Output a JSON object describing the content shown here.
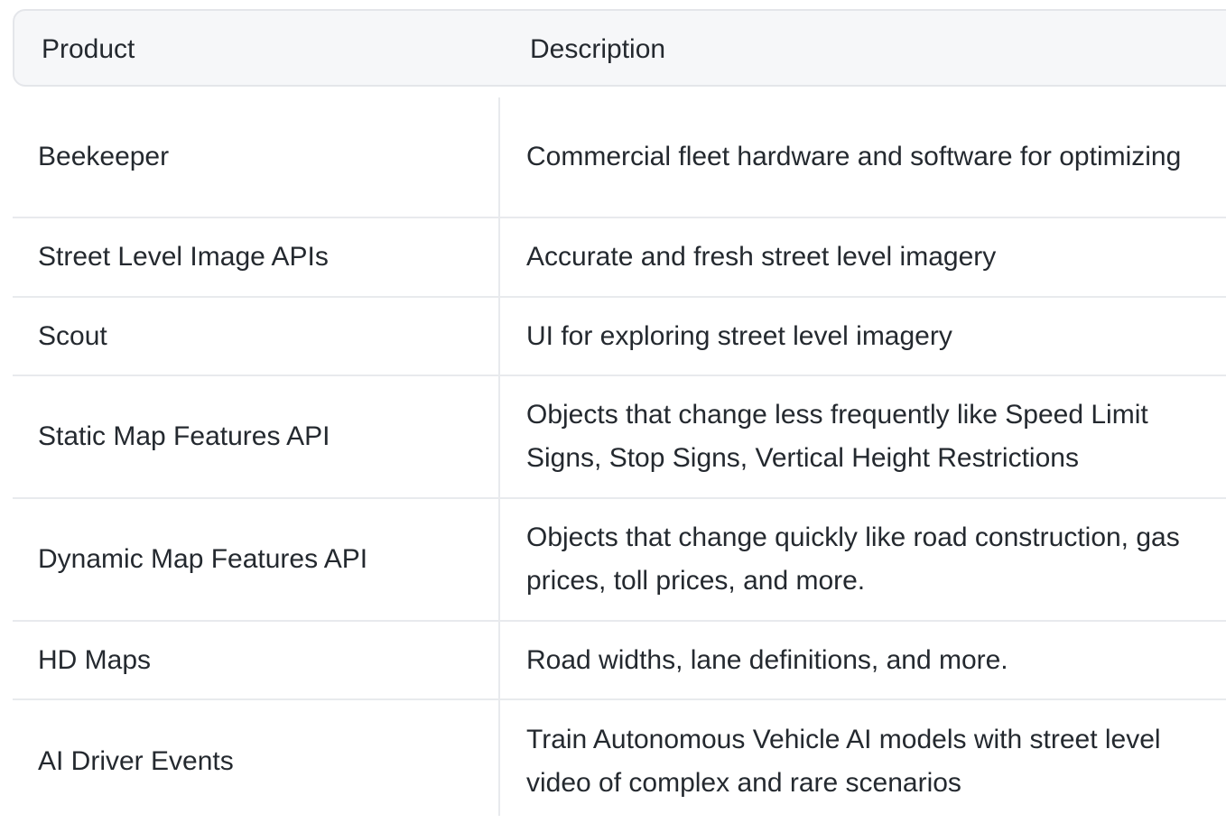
{
  "table": {
    "headers": {
      "product": "Product",
      "description": "Description"
    },
    "rows": [
      {
        "product": "Beekeeper",
        "description": "Commercial fleet hardware and software for optimizing"
      },
      {
        "product": "Street Level Image APIs",
        "description": "Accurate and fresh street level imagery"
      },
      {
        "product": "Scout",
        "description": "UI for exploring street level imagery"
      },
      {
        "product": "Static Map Features API",
        "description": "Objects that change less frequently like Speed Limit Signs, Stop Signs, Vertical Height Restrictions"
      },
      {
        "product": "Dynamic Map Features API",
        "description": "Objects that change quickly like road construction, gas prices, toll prices, and more."
      },
      {
        "product": "HD Maps",
        "description": "Road widths, lane definitions, and more."
      },
      {
        "product": "AI Driver Events",
        "description": "Train Autonomous Vehicle AI models with street level video of complex and rare scenarios"
      }
    ]
  },
  "colors": {
    "header_bg": "#f6f7f9",
    "border": "#e8eaed",
    "text": "#24292f"
  }
}
